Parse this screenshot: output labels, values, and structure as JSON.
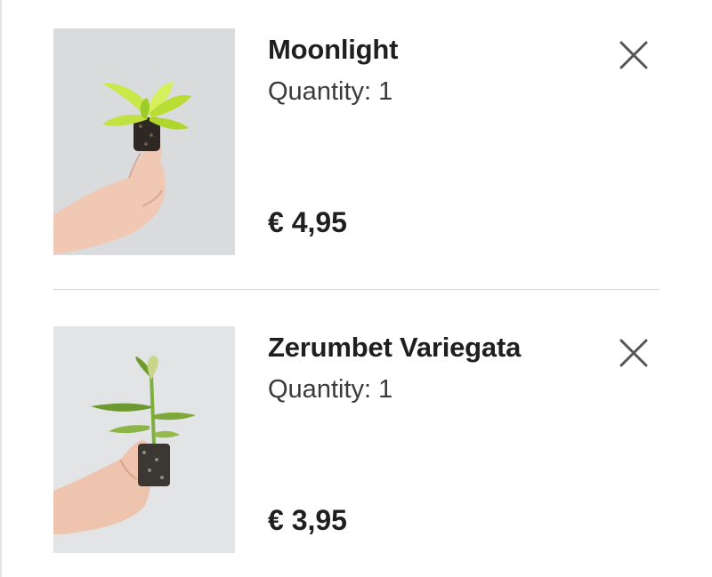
{
  "cart": {
    "items": [
      {
        "name": "Moonlight",
        "quantity": "Quantity: 1",
        "price": "€ 4,95",
        "image_icon": "plant-thumbnail",
        "remove_icon": "close-icon"
      },
      {
        "name": "Zerumbet Variegata",
        "quantity": "Quantity: 1",
        "price": "€ 3,95",
        "image_icon": "plant-thumbnail",
        "remove_icon": "close-icon"
      }
    ]
  },
  "colors": {
    "text": "#1f1f1f",
    "divider": "#d4d4d4",
    "icon": "#555555"
  }
}
